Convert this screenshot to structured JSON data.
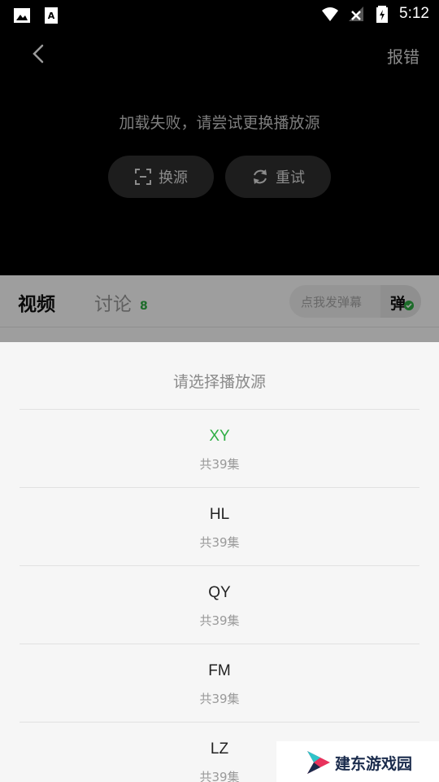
{
  "status_bar": {
    "time": "5:12"
  },
  "video": {
    "report_label": "报错",
    "error_message": "加载失败，请尝试更换播放源",
    "switch_source_label": "换源",
    "retry_label": "重试"
  },
  "tabs": {
    "video_label": "视频",
    "discuss_label": "讨论",
    "discuss_count": "8",
    "danmu_placeholder": "点我发弹幕",
    "danmu_toggle_label": "弹"
  },
  "sheet": {
    "title": "请选择播放源",
    "sources": [
      {
        "name": "XY",
        "episodes": "共39集",
        "active": true
      },
      {
        "name": "HL",
        "episodes": "共39集",
        "active": false
      },
      {
        "name": "QY",
        "episodes": "共39集",
        "active": false
      },
      {
        "name": "FM",
        "episodes": "共39集",
        "active": false
      },
      {
        "name": "LZ",
        "episodes": "共39集",
        "active": false
      }
    ]
  },
  "watermark": {
    "text": "建东游戏园"
  },
  "colors": {
    "accent": "#2fae45",
    "sheet_bg": "#f6f6f6"
  }
}
